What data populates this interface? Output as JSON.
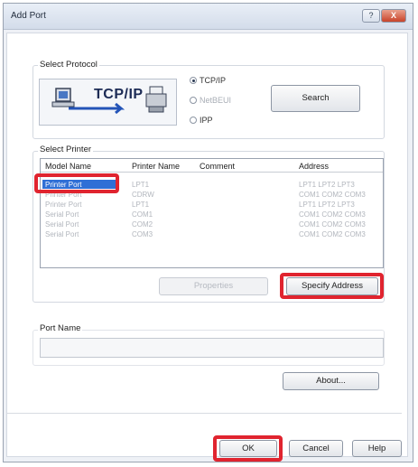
{
  "window": {
    "title": "Add Port",
    "help_glyph": "?",
    "close_glyph": "X"
  },
  "protocol": {
    "group_label": "Select Protocol",
    "banner_text": "TCP/IP",
    "options": [
      {
        "label": "TCP/IP",
        "selected": true,
        "enabled": true
      },
      {
        "label": "NetBEUI",
        "selected": false,
        "enabled": false
      },
      {
        "label": "IPP",
        "selected": false,
        "enabled": true
      }
    ],
    "search_button": "Search"
  },
  "printer": {
    "group_label": "Select Printer",
    "columns": [
      "Model Name",
      "Printer Name",
      "Comment",
      "Address"
    ],
    "rows": [
      {
        "model": "Printer Port",
        "printer": "LPT1",
        "comment": "",
        "address": "LPT1 LPT2 LPT3",
        "selected": true
      },
      {
        "model": "Printer Port",
        "printer": "CDRW",
        "comment": "",
        "address": "COM1 COM2 COM3",
        "selected": false
      },
      {
        "model": "Printer Port",
        "printer": "LPT1",
        "comment": "",
        "address": "LPT1 LPT2 LPT3",
        "selected": false
      },
      {
        "model": "Serial Port",
        "printer": "COM1",
        "comment": "",
        "address": "COM1 COM2 COM3",
        "selected": false
      },
      {
        "model": "Serial Port",
        "printer": "COM2",
        "comment": "",
        "address": "COM1 COM2 COM3",
        "selected": false
      },
      {
        "model": "Serial Port",
        "printer": "COM3",
        "comment": "",
        "address": "COM1 COM2 COM3",
        "selected": false
      }
    ],
    "properties_button": "Properties",
    "specify_address_button": "Specify Address"
  },
  "port": {
    "group_label": "Port Name",
    "value": ""
  },
  "buttons": {
    "about": "About...",
    "ok": "OK",
    "cancel": "Cancel",
    "help": "Help"
  },
  "colors": {
    "highlight": "#e0242f",
    "selection": "#2f6fd6"
  }
}
